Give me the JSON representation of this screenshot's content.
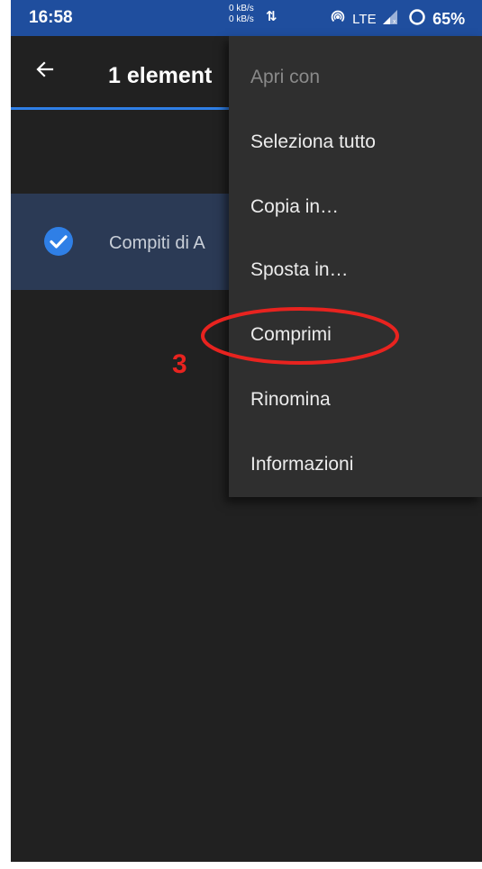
{
  "status_bar": {
    "time": "16:58",
    "net_up": "0 kB/s",
    "net_down": "0 kB/s",
    "network": "LTE",
    "battery": "65%",
    "icons": [
      "hotspot-icon",
      "signal-icon",
      "battery-ring-icon"
    ]
  },
  "app_bar": {
    "title": "1 element",
    "back_icon": "back-arrow-icon"
  },
  "list": {
    "items": [
      {
        "label": "Compiti di A",
        "selected": true
      }
    ]
  },
  "menu": {
    "items": [
      {
        "label": "Apri con",
        "enabled": false
      },
      {
        "label": "Seleziona tutto",
        "enabled": true
      },
      {
        "label": "Copia in…",
        "enabled": true
      },
      {
        "label": "Sposta in…",
        "enabled": true
      },
      {
        "label": "Comprimi",
        "enabled": true,
        "highlighted": true
      },
      {
        "label": "Rinomina",
        "enabled": true
      },
      {
        "label": "Informazioni",
        "enabled": true
      }
    ]
  },
  "annotation": {
    "step_number": "3",
    "color": "#e8231f"
  },
  "colors": {
    "status_bar": "#1f4e9e",
    "background": "#212121",
    "selected_row": "#2b3a55",
    "accent": "#2f7fe6",
    "menu": "#2f2f2f"
  }
}
